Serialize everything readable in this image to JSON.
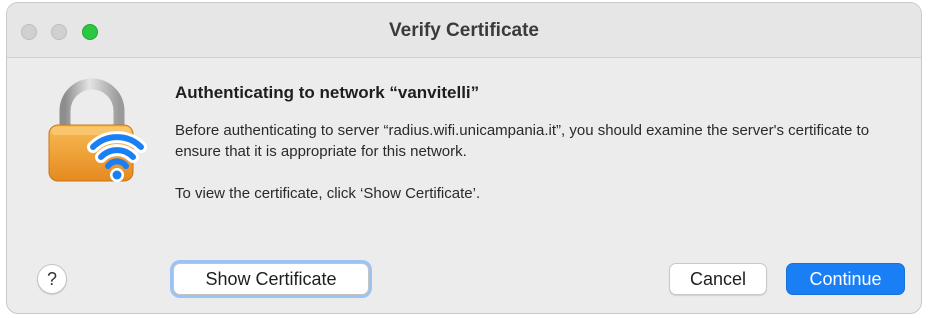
{
  "window": {
    "title": "Verify Certificate"
  },
  "icon": {
    "name": "lock-wifi-icon"
  },
  "message": {
    "heading": "Authenticating to network “vanvitelli”",
    "body": "Before authenticating to server “radius.wifi.unicampania.it”, you should examine the server's certificate to ensure that it is appropriate for this network.",
    "hint": "To view the certificate, click ‘Show Certificate’."
  },
  "buttons": {
    "help": "?",
    "show_certificate": "Show Certificate",
    "cancel": "Cancel",
    "continue": "Continue"
  },
  "colors": {
    "accent": "#1a7ff5",
    "focus_ring": "#9cc3f3",
    "zoom_light": "#2ac840",
    "lock_body": "#f2a43a",
    "wifi": "#1a7ff5"
  }
}
